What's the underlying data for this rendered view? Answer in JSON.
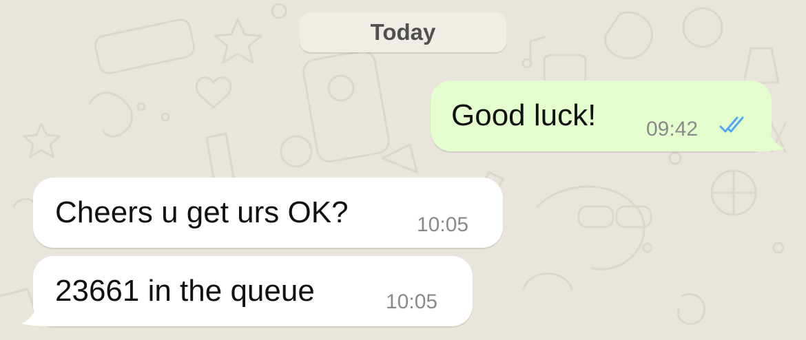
{
  "chat": {
    "date_separator": "Today",
    "messages": [
      {
        "direction": "outgoing",
        "text": "Good luck!",
        "time": "09:42",
        "status_icon": "double-check-read-icon"
      },
      {
        "direction": "incoming",
        "text": "Cheers u get urs OK?",
        "time": "10:05"
      },
      {
        "direction": "incoming",
        "text": "23661 in the queue",
        "time": "10:05"
      }
    ]
  },
  "colors": {
    "wallpaper": "#e9e5dd",
    "outgoing_bubble": "#e3fdcf",
    "incoming_bubble": "#ffffff",
    "read_ticks": "#53a6f0",
    "timestamp": "#8a8a8a"
  }
}
